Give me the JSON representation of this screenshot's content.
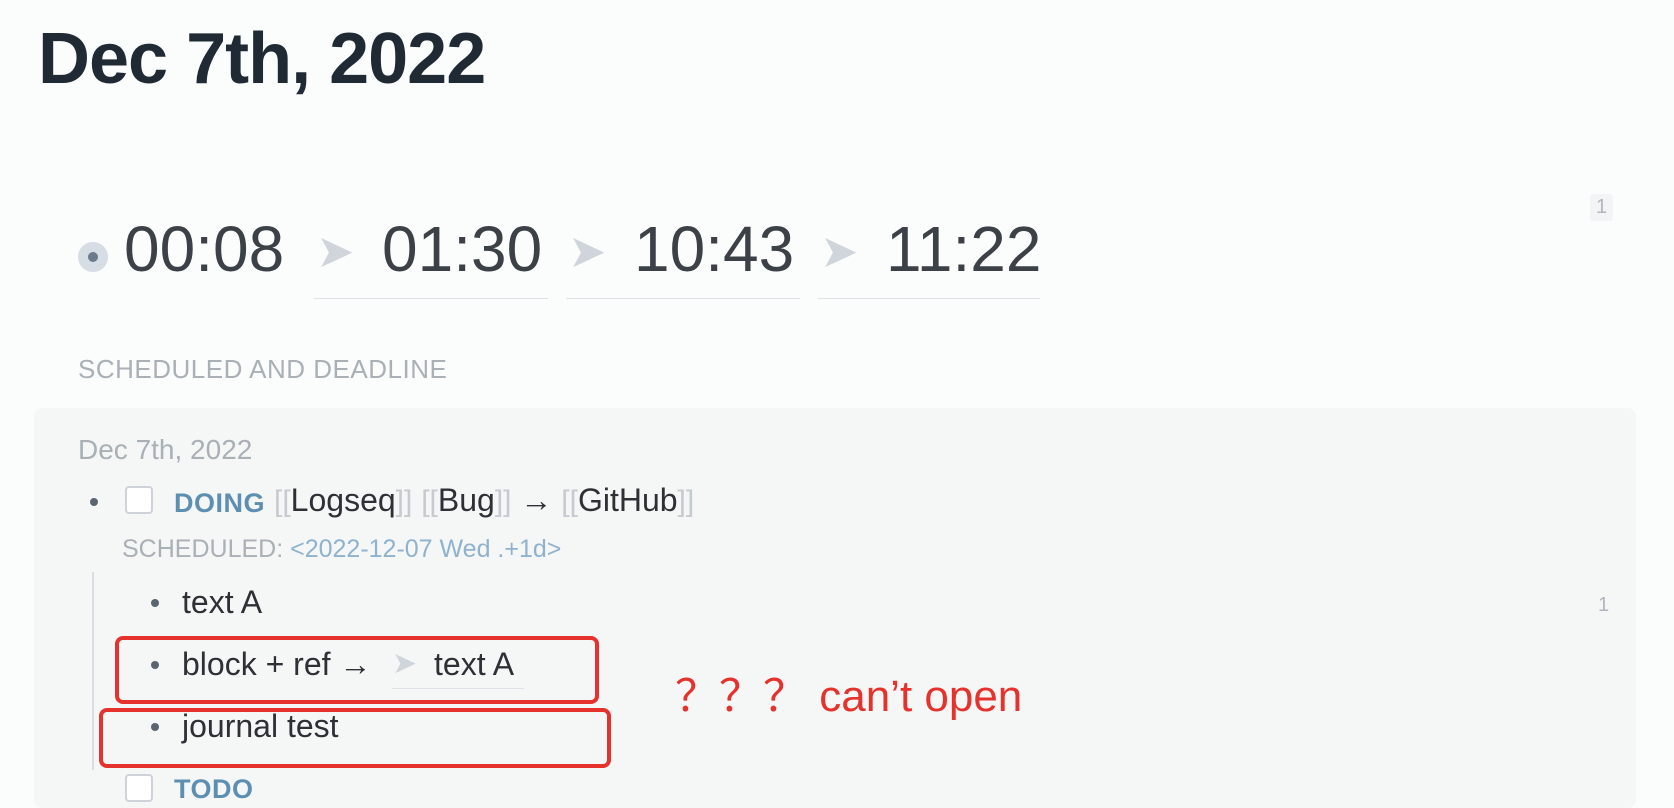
{
  "page": {
    "title": "Dec 7th, 2022"
  },
  "time_block": {
    "start": "00:08",
    "refs": [
      "01:30",
      "10:43",
      "11:22"
    ],
    "ref_arrow": "➤",
    "ref_count": "1"
  },
  "section": {
    "label": "SCHEDULED AND DEADLINE"
  },
  "scheduled_group": {
    "date": "Dec 7th, 2022",
    "task": {
      "marker": "DOING",
      "open_bracket": "[[",
      "close_bracket": "]]",
      "page_1": "Logseq",
      "page_2": "Bug",
      "arrow": "→",
      "page_3": "GitHub",
      "scheduled_key": "SCHEDULED:",
      "scheduled_value": "<2022-12-07 Wed .+1d>"
    },
    "children": [
      {
        "text": "text A",
        "ref_count": "1"
      },
      {
        "text": "block + ref →",
        "ref_arrow": "➤",
        "ref_text": "text A"
      },
      {
        "text": "journal test"
      }
    ],
    "next_task": {
      "marker": "TODO"
    }
  },
  "annotation": {
    "text": "？？？  can’t open",
    "color": "#e5322d"
  }
}
